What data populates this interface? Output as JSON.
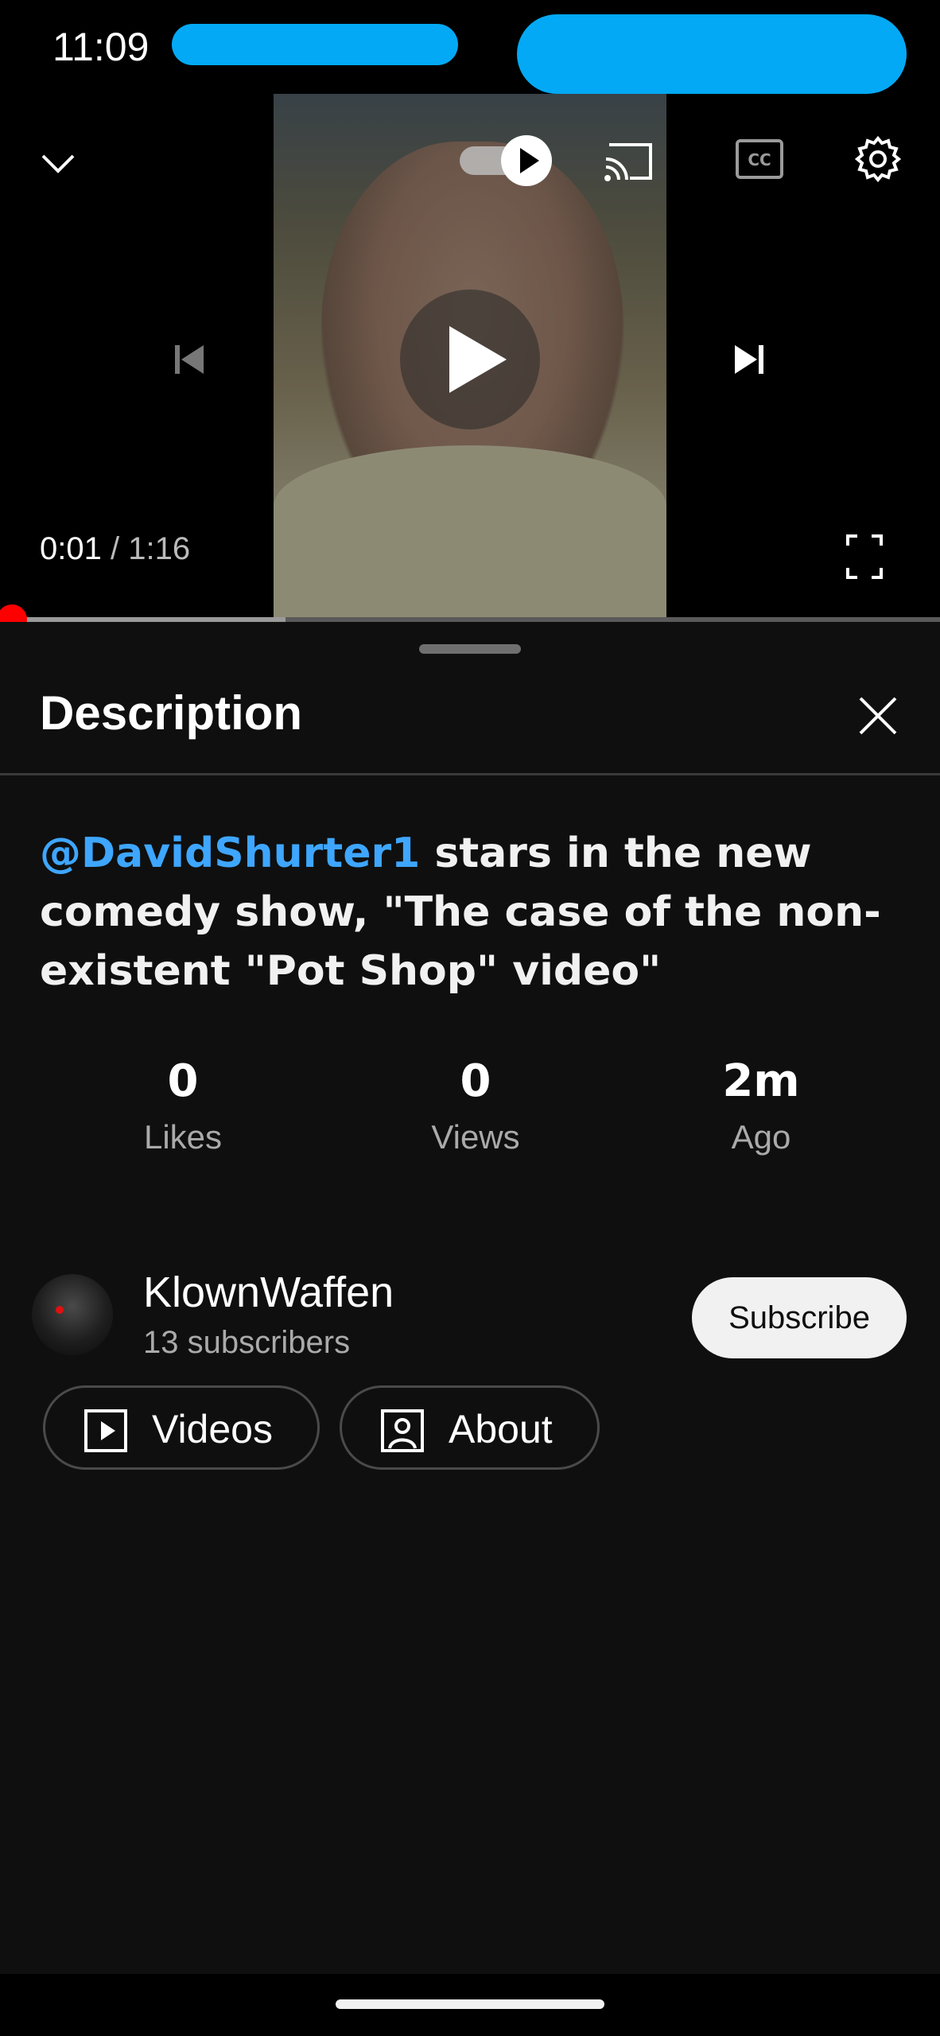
{
  "status_bar": {
    "time": "11:09"
  },
  "player": {
    "current_time": "0:01",
    "time_separator": "/",
    "duration": "1:16",
    "progress_fraction": 0.013,
    "icons": {
      "collapse": "chevron-down-icon",
      "autoplay": "autoplay-toggle",
      "cast": "cast-icon",
      "captions": "closed-captions-icon",
      "settings": "gear-icon",
      "previous": "skip-previous-icon",
      "play": "play-icon",
      "next": "skip-next-icon",
      "fullscreen": "fullscreen-icon"
    }
  },
  "description": {
    "title": "Description",
    "mention": "@DavidShurter1",
    "text": " stars in the new comedy show, \"The case of the non-existent \"Pot Shop\" video\"",
    "stats": [
      {
        "value": "0",
        "label": "Likes"
      },
      {
        "value": "0",
        "label": "Views"
      },
      {
        "value": "2m",
        "label": "Ago"
      }
    ]
  },
  "channel": {
    "name": "KlownWaffen",
    "subscribers": "13 subscribers",
    "subscribe_label": "Subscribe",
    "buttons": [
      {
        "label": "Videos",
        "icon": "video-play-icon"
      },
      {
        "label": "About",
        "icon": "person-icon"
      }
    ]
  },
  "colors": {
    "background": "#0f0f0f",
    "accent_link": "#3ea6ff",
    "progress": "#ff0000",
    "redaction": "#03a9f4"
  }
}
